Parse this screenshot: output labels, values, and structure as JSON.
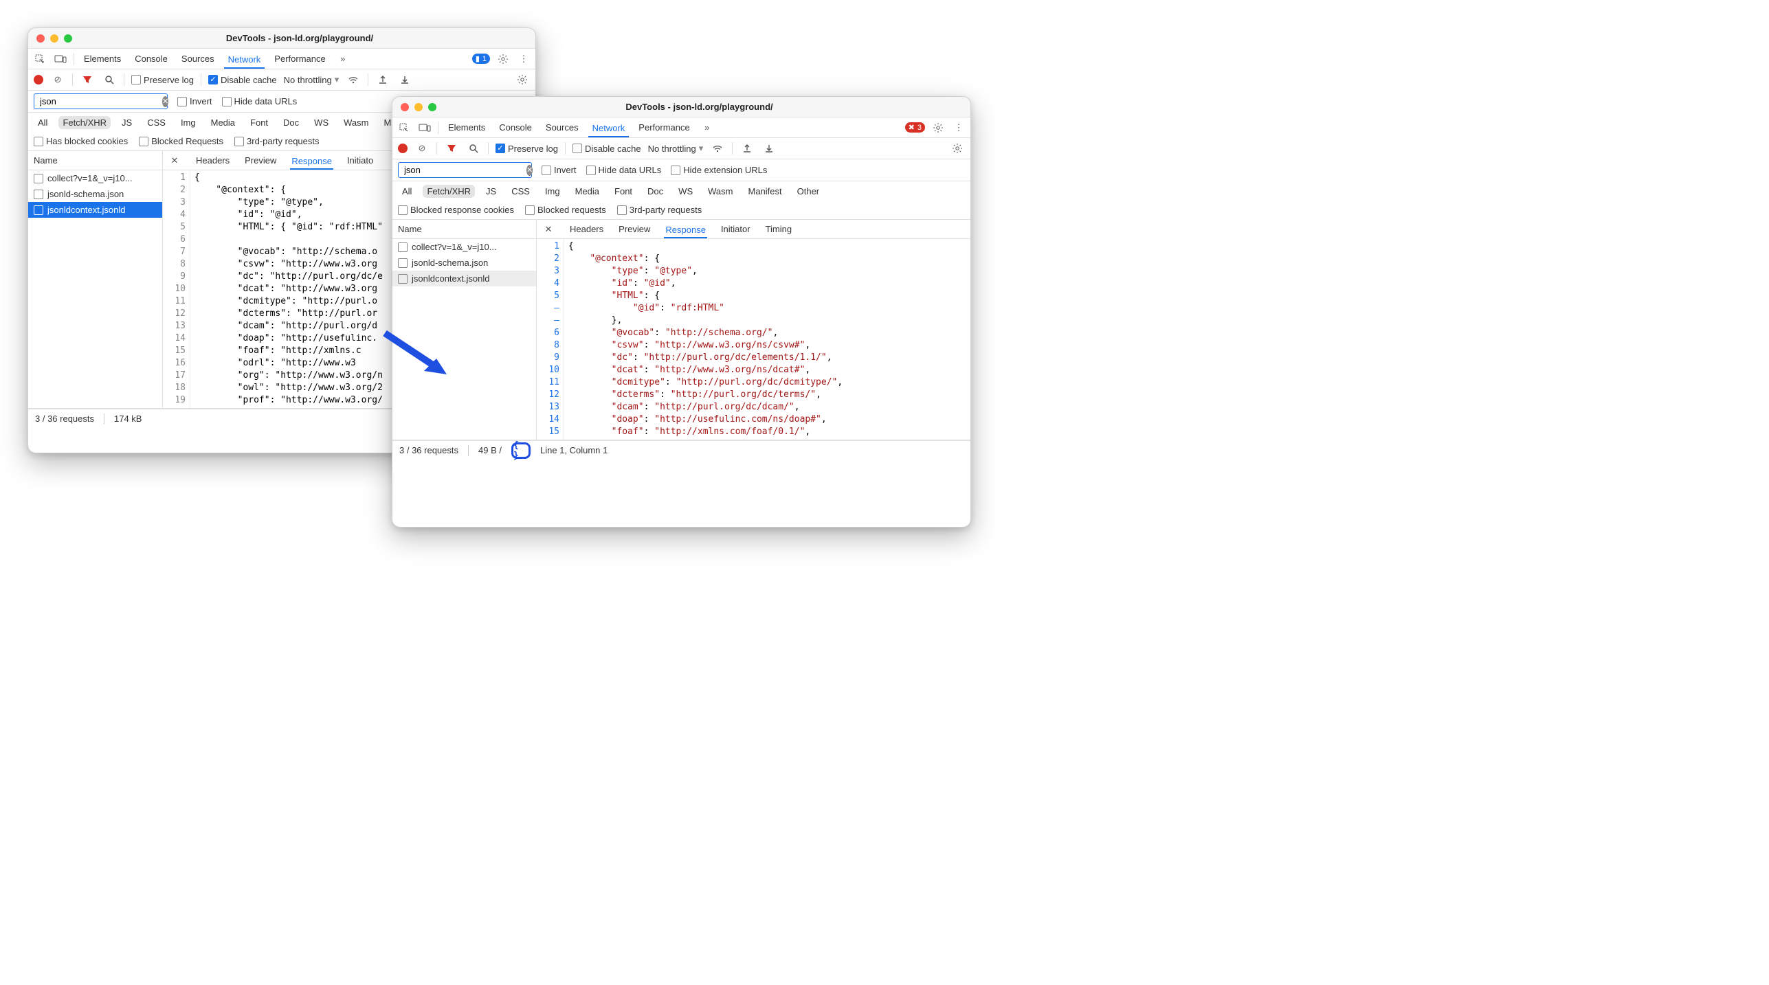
{
  "windowA": {
    "title": "DevTools - json-ld.org/playground/",
    "mainTabs": [
      "Elements",
      "Console",
      "Sources",
      "Network",
      "Performance"
    ],
    "activeTab": "Network",
    "issueBadge": "1",
    "toolbar": {
      "preserve_log_label": "Preserve log",
      "preserve_log_checked": false,
      "disable_cache_label": "Disable cache",
      "disable_cache_checked": true,
      "throttling": "No throttling"
    },
    "filter": {
      "value": "json",
      "invert_label": "Invert",
      "hide_data_urls_label": "Hide data URLs"
    },
    "types": [
      "All",
      "Fetch/XHR",
      "JS",
      "CSS",
      "Img",
      "Media",
      "Font",
      "Doc",
      "WS",
      "Wasm",
      "Manifest"
    ],
    "types_selected": "Fetch/XHR",
    "checks": {
      "blocked_cookies": "Has blocked cookies",
      "blocked_requests": "Blocked Requests",
      "third_party": "3rd-party requests"
    },
    "name_header": "Name",
    "requests": [
      {
        "name": "collect?v=1&_v=j10...",
        "selected": false
      },
      {
        "name": "jsonld-schema.json",
        "selected": false
      },
      {
        "name": "jsonldcontext.jsonld",
        "selected": true
      }
    ],
    "req_tabs": [
      "Headers",
      "Preview",
      "Response",
      "Initiato"
    ],
    "req_active": "Response",
    "gutter": [
      "1",
      "2",
      "3",
      "4",
      "5",
      "6",
      "7",
      "8",
      "9",
      "10",
      "11",
      "12",
      "13",
      "14",
      "15",
      "16",
      "17",
      "18",
      "19"
    ],
    "codeLines": [
      "{",
      "    \"@context\": {",
      "        \"type\": \"@type\",",
      "        \"id\": \"@id\",",
      "        \"HTML\": { \"@id\": \"rdf:HTML\"",
      "",
      "        \"@vocab\": \"http://schema.o",
      "        \"csvw\": \"http://www.w3.org",
      "        \"dc\": \"http://purl.org/dc/e",
      "        \"dcat\": \"http://www.w3.org",
      "        \"dcmitype\": \"http://purl.o",
      "        \"dcterms\": \"http://purl.or",
      "        \"dcam\": \"http://purl.org/d",
      "        \"doap\": \"http://usefulinc.",
      "        \"foaf\": \"http://xmlns.c",
      "        \"odrl\": \"http://www.w3",
      "        \"org\": \"http://www.w3.org/n",
      "        \"owl\": \"http://www.w3.org/2",
      "        \"prof\": \"http://www.w3.org/"
    ],
    "status": {
      "requests": "3 / 36 requests",
      "size": "174 kB"
    }
  },
  "windowB": {
    "title": "DevTools - json-ld.org/playground/",
    "mainTabs": [
      "Elements",
      "Console",
      "Sources",
      "Network",
      "Performance"
    ],
    "activeTab": "Network",
    "errorBadge": "3",
    "toolbar": {
      "preserve_log_label": "Preserve log",
      "preserve_log_checked": true,
      "disable_cache_label": "Disable cache",
      "disable_cache_checked": false,
      "throttling": "No throttling"
    },
    "filter": {
      "value": "json",
      "invert_label": "Invert",
      "hide_data_urls_label": "Hide data URLs",
      "hide_ext_urls_label": "Hide extension URLs"
    },
    "types": [
      "All",
      "Fetch/XHR",
      "JS",
      "CSS",
      "Img",
      "Media",
      "Font",
      "Doc",
      "WS",
      "Wasm",
      "Manifest",
      "Other"
    ],
    "types_selected": "Fetch/XHR",
    "checks": {
      "blocked_cookies": "Blocked response cookies",
      "blocked_requests": "Blocked requests",
      "third_party": "3rd-party requests"
    },
    "name_header": "Name",
    "requests": [
      {
        "name": "collect?v=1&_v=j10...",
        "selected": false
      },
      {
        "name": "jsonld-schema.json",
        "selected": false
      },
      {
        "name": "jsonldcontext.jsonld",
        "selected": false,
        "hover": true
      }
    ],
    "req_tabs": [
      "Headers",
      "Preview",
      "Response",
      "Initiator",
      "Timing"
    ],
    "req_active": "Response",
    "gutter": [
      "1",
      "2",
      "3",
      "4",
      "5",
      "–",
      "–",
      "6",
      "8",
      "9",
      "10",
      "11",
      "12",
      "13",
      "14",
      "15"
    ],
    "codeLines": [
      {
        "t": "{"
      },
      {
        "i": 1,
        "k": "\"@context\"",
        "p": ": {"
      },
      {
        "i": 2,
        "k": "\"type\"",
        "p": ": ",
        "v": "\"@type\"",
        "c": ","
      },
      {
        "i": 2,
        "k": "\"id\"",
        "p": ": ",
        "v": "\"@id\"",
        "c": ","
      },
      {
        "i": 2,
        "k": "\"HTML\"",
        "p": ": {"
      },
      {
        "i": 3,
        "k": "\"@id\"",
        "p": ": ",
        "v": "\"rdf:HTML\""
      },
      {
        "i": 2,
        "t": "},"
      },
      {
        "i": 2,
        "k": "\"@vocab\"",
        "p": ": ",
        "v": "\"http://schema.org/\"",
        "c": ","
      },
      {
        "i": 2,
        "k": "\"csvw\"",
        "p": ": ",
        "v": "\"http://www.w3.org/ns/csvw#\"",
        "c": ","
      },
      {
        "i": 2,
        "k": "\"dc\"",
        "p": ": ",
        "v": "\"http://purl.org/dc/elements/1.1/\"",
        "c": ","
      },
      {
        "i": 2,
        "k": "\"dcat\"",
        "p": ": ",
        "v": "\"http://www.w3.org/ns/dcat#\"",
        "c": ","
      },
      {
        "i": 2,
        "k": "\"dcmitype\"",
        "p": ": ",
        "v": "\"http://purl.org/dc/dcmitype/\"",
        "c": ","
      },
      {
        "i": 2,
        "k": "\"dcterms\"",
        "p": ": ",
        "v": "\"http://purl.org/dc/terms/\"",
        "c": ","
      },
      {
        "i": 2,
        "k": "\"dcam\"",
        "p": ": ",
        "v": "\"http://purl.org/dc/dcam/\"",
        "c": ","
      },
      {
        "i": 2,
        "k": "\"doap\"",
        "p": ": ",
        "v": "\"http://usefulinc.com/ns/doap#\"",
        "c": ","
      },
      {
        "i": 2,
        "k": "\"foaf\"",
        "p": ": ",
        "v": "\"http://xmlns.com/foaf/0.1/\"",
        "c": ","
      }
    ],
    "status": {
      "requests": "3 / 36 requests",
      "size": "49 B /",
      "cursor": "Line 1, Column 1",
      "pretty": "{ }"
    }
  }
}
